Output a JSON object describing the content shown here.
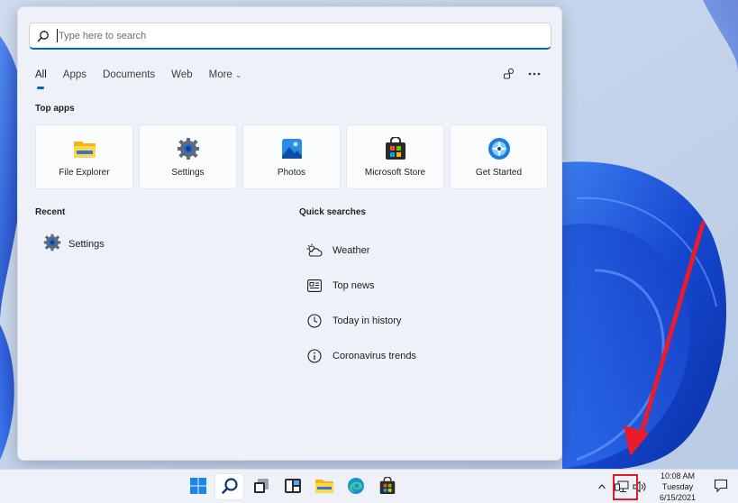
{
  "search": {
    "placeholder": "Type here to search",
    "value": ""
  },
  "tabs": [
    {
      "label": "All",
      "active": true
    },
    {
      "label": "Apps"
    },
    {
      "label": "Documents"
    },
    {
      "label": "Web"
    },
    {
      "label": "More"
    }
  ],
  "tab_icons": [
    "feedback-icon",
    "more-options-icon"
  ],
  "top_apps": {
    "title": "Top apps",
    "items": [
      {
        "label": "File Explorer",
        "icon": "file-explorer-icon"
      },
      {
        "label": "Settings",
        "icon": "settings-gear-icon"
      },
      {
        "label": "Photos",
        "icon": "photos-icon"
      },
      {
        "label": "Microsoft Store",
        "icon": "store-icon"
      },
      {
        "label": "Get Started",
        "icon": "get-started-icon"
      }
    ]
  },
  "recent": {
    "title": "Recent",
    "items": [
      {
        "label": "Settings",
        "icon": "settings-gear-icon"
      }
    ]
  },
  "quick_searches": {
    "title": "Quick searches",
    "items": [
      {
        "label": "Weather",
        "icon": "weather-icon"
      },
      {
        "label": "Top news",
        "icon": "news-icon"
      },
      {
        "label": "Today in history",
        "icon": "clock-icon"
      },
      {
        "label": "Coronavirus trends",
        "icon": "info-icon"
      }
    ]
  },
  "taskbar": {
    "apps": [
      "start",
      "search",
      "task-view",
      "widgets",
      "file-explorer",
      "edge",
      "store"
    ],
    "clock": {
      "time": "10:08 AM",
      "day": "Tuesday",
      "date": "6/15/2021"
    }
  },
  "colors": {
    "accent": "#0067c0",
    "highlight": "#e01a2a",
    "wallpaper": "#1a4fd0"
  }
}
